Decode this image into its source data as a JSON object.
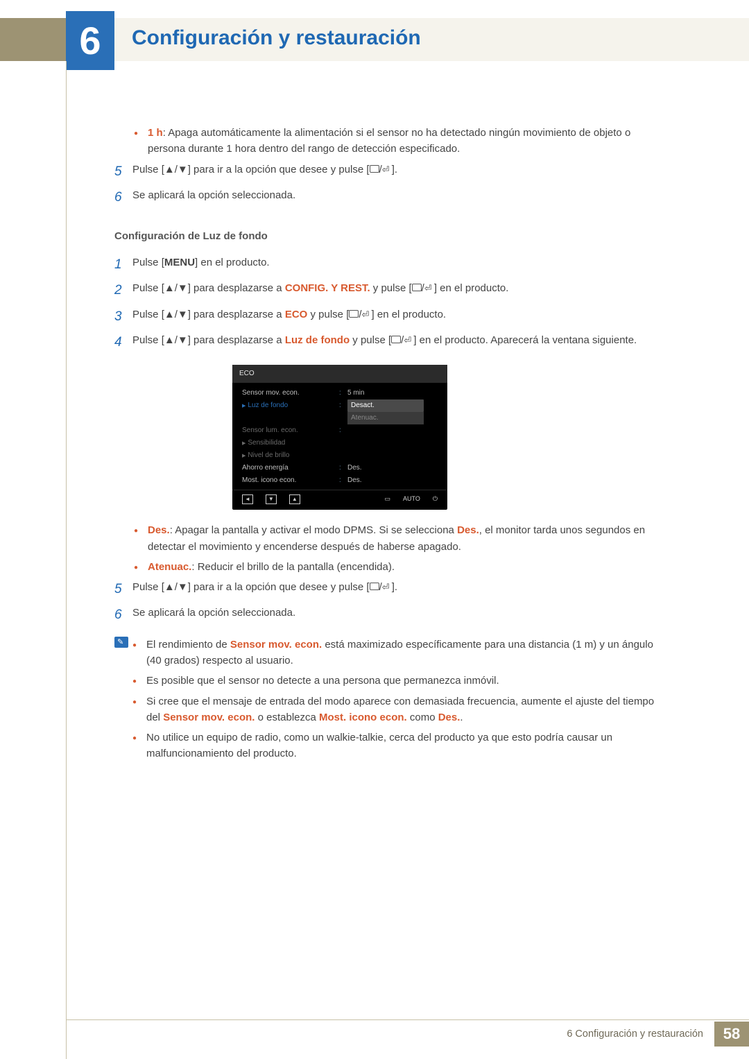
{
  "chapter": {
    "number": "6",
    "title": "Configuración y restauración"
  },
  "intro_bullet": {
    "lead": "1 h",
    "text": ": Apaga automáticamente la alimentación si el sensor no ha detectado ningún movimiento de objeto o persona durante 1 hora dentro del rango de detección especificado."
  },
  "top_steps": {
    "s5": "Pulse [▲/▼] para ir a la opción que desee y pulse [",
    "s5_tail": "].",
    "s6": "Se aplicará la opción seleccionada."
  },
  "section_head": "Configuración de Luz de fondo",
  "steps": {
    "s1": {
      "pre": "Pulse [",
      "menu": "MENU",
      "post": "] en el producto."
    },
    "s2": {
      "pre": "Pulse [▲/▼] para desplazarse a ",
      "hl": "CONFIG. Y REST.",
      "mid": " y pulse [",
      "post": "] en el producto."
    },
    "s3": {
      "pre": "Pulse [▲/▼] para desplazarse a ",
      "hl": "ECO",
      "mid": " y pulse [",
      "post": "] en el producto."
    },
    "s4": {
      "pre": "Pulse [▲/▼] para desplazarse a ",
      "hl": "Luz de fondo",
      "mid": " y pulse [",
      "post": "] en el producto. Aparecerá la ventana siguiente."
    },
    "s5": {
      "text": "Pulse [▲/▼] para ir a la opción que desee y pulse [",
      "tail": "]."
    },
    "s6": {
      "text": "Se aplicará la opción seleccionada."
    }
  },
  "osd": {
    "title": "ECO",
    "rows": {
      "sensor_mov": {
        "label": "Sensor mov. econ.",
        "value": "5 min"
      },
      "luz": {
        "label": "Luz de fondo",
        "opt1": "Desact.",
        "opt2": "Atenuac."
      },
      "sensor_lum": {
        "label": "Sensor lum. econ."
      },
      "sens": {
        "label": "Sensibilidad"
      },
      "nivel": {
        "label": "Nivel de brillo"
      },
      "ahorro": {
        "label": "Ahorro energía",
        "value": "Des."
      },
      "most": {
        "label": "Most. icono econ.",
        "value": "Des."
      }
    },
    "footer": {
      "auto": "AUTO"
    }
  },
  "post_osd_bullets": {
    "b1": {
      "lead": "Des.",
      "text": ": Apagar la pantalla y activar el modo DPMS. Si se selecciona ",
      "hl": "Des.",
      "tail": ", el monitor tarda unos segundos en detectar el movimiento y encenderse después de haberse apagado."
    },
    "b2": {
      "lead": "Atenuac.",
      "text": ": Reducir el brillo de la pantalla (encendida)."
    }
  },
  "notes": {
    "n1": {
      "pre": "El rendimiento de ",
      "hl": "Sensor mov. econ.",
      "post": " está maximizado específicamente para una distancia (1 m) y un ángulo (40 grados) respecto al usuario."
    },
    "n2": "Es posible que el sensor no detecte a una persona que permanezca inmóvil.",
    "n3": {
      "pre": "Si cree que el mensaje de entrada del modo aparece con demasiada frecuencia, aumente el ajuste del tiempo del ",
      "hl1": "Sensor mov. econ.",
      "mid": " o establezca ",
      "hl2": "Most. icono econ.",
      "mid2": " como ",
      "hl3": "Des.",
      "post": "."
    },
    "n4": "No utilice un equipo de radio, como un walkie-talkie, cerca del producto ya que esto podría causar un malfuncionamiento del producto."
  },
  "footer": {
    "text": "6 Configuración y restauración",
    "page": "58"
  }
}
